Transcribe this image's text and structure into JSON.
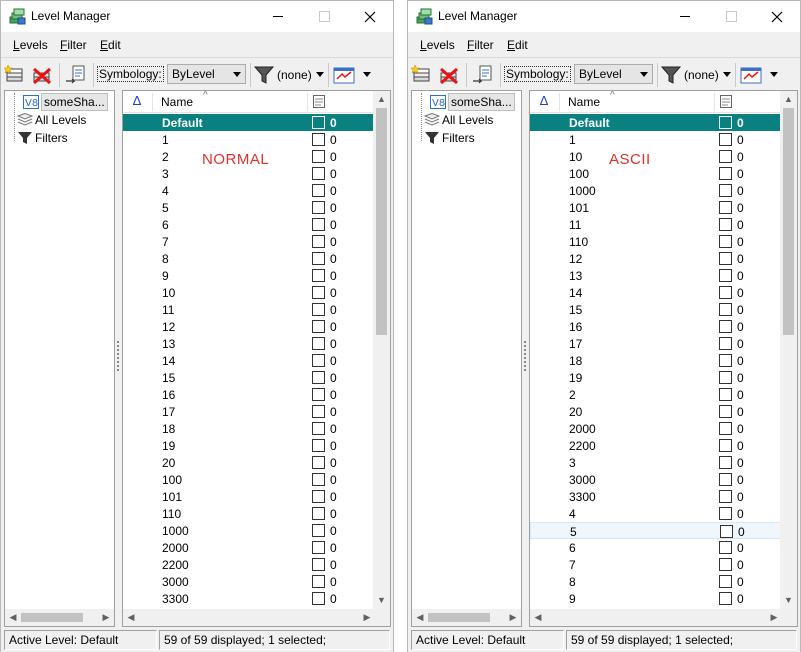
{
  "windows": [
    {
      "id": "left",
      "title": "Level Manager",
      "menu": [
        "Levels",
        "Filter",
        "Edit"
      ],
      "menu_mnemonics": [
        "L",
        "F",
        "E"
      ],
      "toolbar": {
        "symbology_label": "Symbology:",
        "symbology_value": "ByLevel",
        "filter_value": "(none)"
      },
      "tree": [
        {
          "label": "someSha...",
          "icon": "v8-model-icon",
          "selected": true
        },
        {
          "label": "All Levels",
          "icon": "levels-stack-icon",
          "selected": false
        },
        {
          "label": "Filters",
          "icon": "funnel-icon",
          "selected": false
        }
      ],
      "list": {
        "header": {
          "sort_icon": "delta-icon",
          "name": "Name"
        },
        "rows": [
          {
            "name": "Default",
            "value": "0"
          },
          {
            "name": "1",
            "value": "0"
          },
          {
            "name": "2",
            "value": "0"
          },
          {
            "name": "3",
            "value": "0"
          },
          {
            "name": "4",
            "value": "0"
          },
          {
            "name": "5",
            "value": "0"
          },
          {
            "name": "6",
            "value": "0"
          },
          {
            "name": "7",
            "value": "0"
          },
          {
            "name": "8",
            "value": "0"
          },
          {
            "name": "9",
            "value": "0"
          },
          {
            "name": "10",
            "value": "0"
          },
          {
            "name": "11",
            "value": "0"
          },
          {
            "name": "12",
            "value": "0"
          },
          {
            "name": "13",
            "value": "0"
          },
          {
            "name": "14",
            "value": "0"
          },
          {
            "name": "15",
            "value": "0"
          },
          {
            "name": "16",
            "value": "0"
          },
          {
            "name": "17",
            "value": "0"
          },
          {
            "name": "18",
            "value": "0"
          },
          {
            "name": "19",
            "value": "0"
          },
          {
            "name": "20",
            "value": "0"
          },
          {
            "name": "100",
            "value": "0"
          },
          {
            "name": "101",
            "value": "0"
          },
          {
            "name": "110",
            "value": "0"
          },
          {
            "name": "1000",
            "value": "0"
          },
          {
            "name": "2000",
            "value": "0"
          },
          {
            "name": "2200",
            "value": "0"
          },
          {
            "name": "3000",
            "value": "0"
          },
          {
            "name": "3300",
            "value": "0"
          }
        ],
        "selected_index": 0,
        "hover_index": -1
      },
      "overlay_text": "NORMAL",
      "status": {
        "active_level": "Active Level: Default",
        "summary": "59 of 59 displayed; 1 selected;"
      }
    },
    {
      "id": "right",
      "title": "Level Manager",
      "menu": [
        "Levels",
        "Filter",
        "Edit"
      ],
      "menu_mnemonics": [
        "L",
        "F",
        "E"
      ],
      "toolbar": {
        "symbology_label": "Symbology:",
        "symbology_value": "ByLevel",
        "filter_value": "(none)"
      },
      "tree": [
        {
          "label": "someSha...",
          "icon": "v8-model-icon",
          "selected": true
        },
        {
          "label": "All Levels",
          "icon": "levels-stack-icon",
          "selected": false
        },
        {
          "label": "Filters",
          "icon": "funnel-icon",
          "selected": false
        }
      ],
      "list": {
        "header": {
          "sort_icon": "delta-icon",
          "name": "Name"
        },
        "rows": [
          {
            "name": "Default",
            "value": "0"
          },
          {
            "name": "1",
            "value": "0"
          },
          {
            "name": "10",
            "value": "0"
          },
          {
            "name": "100",
            "value": "0"
          },
          {
            "name": "1000",
            "value": "0"
          },
          {
            "name": "101",
            "value": "0"
          },
          {
            "name": "11",
            "value": "0"
          },
          {
            "name": "110",
            "value": "0"
          },
          {
            "name": "12",
            "value": "0"
          },
          {
            "name": "13",
            "value": "0"
          },
          {
            "name": "14",
            "value": "0"
          },
          {
            "name": "15",
            "value": "0"
          },
          {
            "name": "16",
            "value": "0"
          },
          {
            "name": "17",
            "value": "0"
          },
          {
            "name": "18",
            "value": "0"
          },
          {
            "name": "19",
            "value": "0"
          },
          {
            "name": "2",
            "value": "0"
          },
          {
            "name": "20",
            "value": "0"
          },
          {
            "name": "2000",
            "value": "0"
          },
          {
            "name": "2200",
            "value": "0"
          },
          {
            "name": "3",
            "value": "0"
          },
          {
            "name": "3000",
            "value": "0"
          },
          {
            "name": "3300",
            "value": "0"
          },
          {
            "name": "4",
            "value": "0"
          },
          {
            "name": "5",
            "value": "0"
          },
          {
            "name": "6",
            "value": "0"
          },
          {
            "name": "7",
            "value": "0"
          },
          {
            "name": "8",
            "value": "0"
          },
          {
            "name": "9",
            "value": "0"
          }
        ],
        "selected_index": 0,
        "hover_index": 24
      },
      "overlay_text": "ASCII",
      "status": {
        "active_level": "Active Level: Default",
        "summary": "59 of 59 displayed; 1 selected;"
      }
    }
  ],
  "colors": {
    "selection": "#0b8080",
    "overlay": "#e0302c",
    "sort_icon": "#1f3ccf"
  }
}
